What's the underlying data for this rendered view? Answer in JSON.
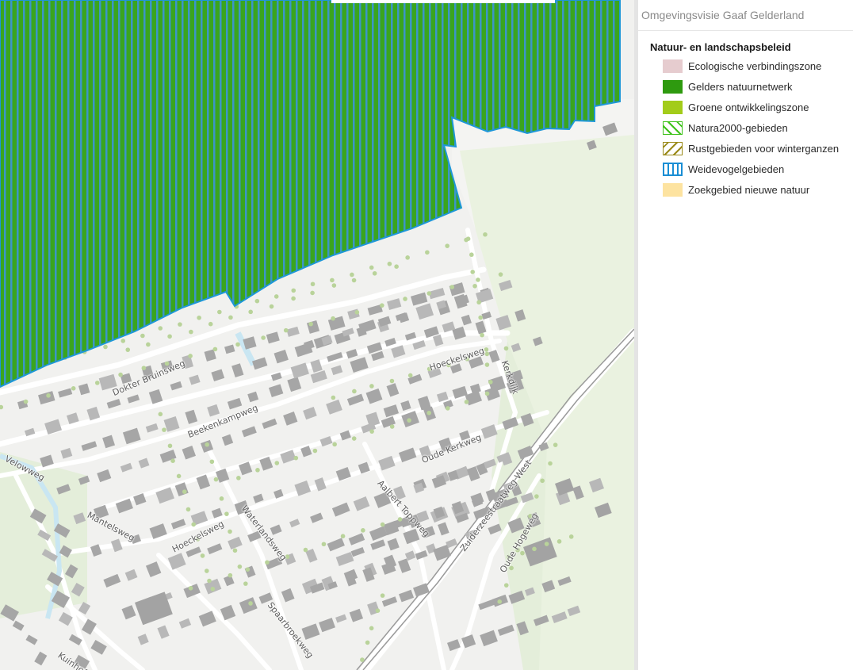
{
  "panel": {
    "title": "Omgevingsvisie Gaaf Gelderland",
    "legend_heading": "Natuur- en landschapsbeleid",
    "items": [
      {
        "label": "Ecologische verbindingszone",
        "icon": "ecologische-verbindingszone-swatch",
        "color": "#e6cccf"
      },
      {
        "label": "Gelders natuurnetwerk",
        "icon": "gelders-natuurnetwerk-swatch",
        "color": "#2e9a0f"
      },
      {
        "label": "Groene ontwikkelingszone",
        "icon": "groene-ontwikkelingszone-swatch",
        "color": "#a3cc1a"
      },
      {
        "label": "Natura2000-gebieden",
        "icon": "natura2000-swatch",
        "color": "#3ec21a"
      },
      {
        "label": "Rustgebieden voor winterganzen",
        "icon": "rustgebieden-swatch",
        "color": "#9a8a1a"
      },
      {
        "label": "Weidevogelgebieden",
        "icon": "weidevogelgebieden-swatch",
        "color": "#1a8ed4"
      },
      {
        "label": "Zoekgebied nieuwe natuur",
        "icon": "zoekgebied-swatch",
        "color": "#fde3a0"
      }
    ]
  },
  "map": {
    "streets": [
      "Dokter Bruinsweg",
      "Beekenkampweg",
      "Hoeckelsweg",
      "Hoeckelsweg",
      "Oude Kerkweg",
      "Kerkdijk",
      "Velowweg",
      "Mantelsweg",
      "Waterlandsweg",
      "Aalbert Toppweg",
      "Zuiderzeestraatweg West",
      "Oude Hogeweg",
      "Spaarbroekweg",
      "Kuinhof"
    ],
    "colors": {
      "nature_green": "#3aa51e",
      "stripe_blue": "#3c95c8",
      "outline_blue": "#1e97d8",
      "base": "#f1f1ef",
      "field": "#e6f0dc",
      "building": "#a8a8a8",
      "road": "#ffffff",
      "water": "#c9e6f2"
    }
  }
}
